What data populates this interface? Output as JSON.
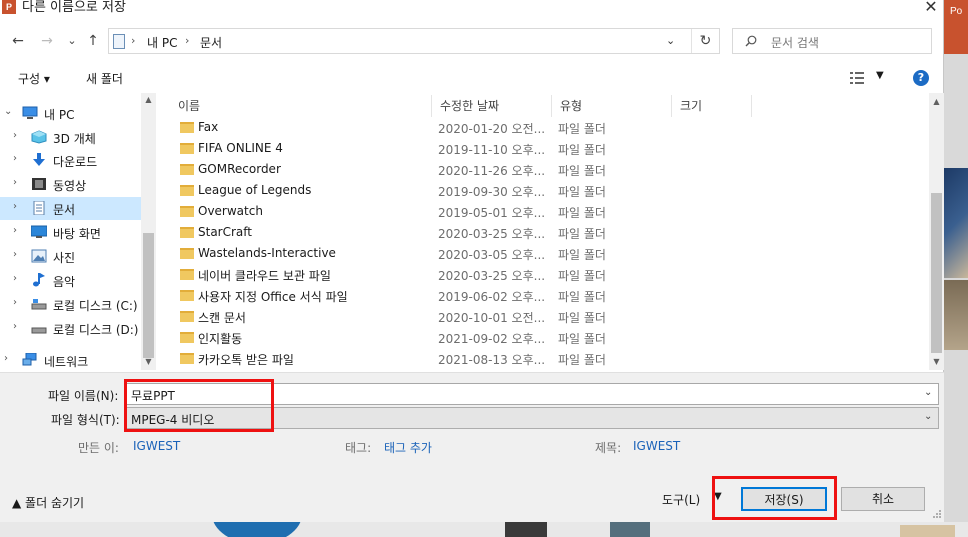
{
  "background_app": {
    "corner_text": "Po"
  },
  "dialog": {
    "app_icon": "P",
    "title": "다른 이름으로 저장",
    "close_glyph": "✕"
  },
  "nav": {
    "back_glyph": "←",
    "forward_glyph": "→",
    "recent_glyph": "⌄",
    "up_glyph": "↑",
    "breadcrumb": [
      "내 PC",
      "문서"
    ],
    "breadcrumb_sep": "›",
    "refresh_glyph": "↻",
    "search_placeholder": "문서 검색"
  },
  "toolbar": {
    "organize_label": "구성 ▾",
    "new_folder_label": "새 폴더",
    "help_glyph": "?"
  },
  "navpane": {
    "items": [
      {
        "label": "내 PC",
        "icon": "computer-icon",
        "expanded": true
      },
      {
        "label": "3D 개체",
        "icon": "cube-icon"
      },
      {
        "label": "다운로드",
        "icon": "download-icon"
      },
      {
        "label": "동영상",
        "icon": "video-icon"
      },
      {
        "label": "문서",
        "icon": "document-icon",
        "selected": true
      },
      {
        "label": "바탕 화면",
        "icon": "desktop-icon"
      },
      {
        "label": "사진",
        "icon": "picture-icon"
      },
      {
        "label": "음악",
        "icon": "music-icon"
      },
      {
        "label": "로컬 디스크 (C:)",
        "icon": "drive-icon"
      },
      {
        "label": "로컬 디스크 (D:)",
        "icon": "drive-icon"
      },
      {
        "label": "네트워크",
        "icon": "network-icon"
      }
    ]
  },
  "filelist": {
    "columns": [
      "이름",
      "수정한 날짜",
      "유형",
      "크기"
    ],
    "rows": [
      {
        "name": "Fax",
        "date": "2020-01-20 오전...",
        "type": "파일 폴더"
      },
      {
        "name": "FIFA ONLINE 4",
        "date": "2019-11-10 오후...",
        "type": "파일 폴더"
      },
      {
        "name": "GOMRecorder",
        "date": "2020-11-26 오후...",
        "type": "파일 폴더"
      },
      {
        "name": "League of Legends",
        "date": "2019-09-30 오후...",
        "type": "파일 폴더"
      },
      {
        "name": "Overwatch",
        "date": "2019-05-01 오후...",
        "type": "파일 폴더"
      },
      {
        "name": "StarCraft",
        "date": "2020-03-25 오후...",
        "type": "파일 폴더"
      },
      {
        "name": "Wastelands-Interactive",
        "date": "2020-03-05 오후...",
        "type": "파일 폴더"
      },
      {
        "name": "네이버 클라우드 보관 파일",
        "date": "2020-03-25 오후...",
        "type": "파일 폴더"
      },
      {
        "name": "사용자 지정 Office 서식 파일",
        "date": "2019-06-02 오후...",
        "type": "파일 폴더"
      },
      {
        "name": "스캔 문서",
        "date": "2020-10-01 오전...",
        "type": "파일 폴더"
      },
      {
        "name": "인지활동",
        "date": "2021-09-02 오후...",
        "type": "파일 폴더"
      },
      {
        "name": "카카오톡 받은 파일",
        "date": "2021-08-13 오후...",
        "type": "파일 폴더"
      }
    ]
  },
  "form": {
    "filename_label": "파일 이름(N):",
    "filename_value": "무료PPT",
    "filetype_label": "파일 형식(T):",
    "filetype_value": "MPEG-4 비디오",
    "author_label": "만든 이:",
    "author_value": "IGWEST",
    "tags_label": "태그:",
    "tags_value": "태그 추가",
    "title_label": "제목:",
    "title_value": "IGWEST"
  },
  "footer": {
    "hide_folders_label": "▲  폴더 숨기기",
    "tools_label": "도구(L)",
    "save_label": "저장(S)",
    "cancel_label": "취소"
  },
  "colors": {
    "highlight": "#ee1111",
    "accent": "#0078d7",
    "selected_bg": "#cce8ff",
    "link": "#1a62b8"
  }
}
